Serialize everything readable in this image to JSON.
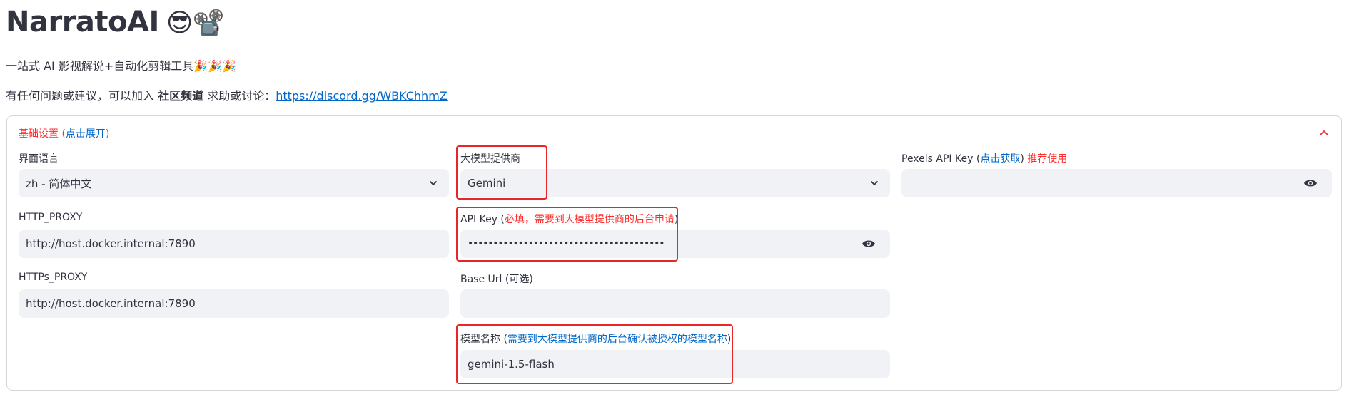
{
  "header": {
    "app_title": "NarratoAI",
    "title_emoji": "😎📽️",
    "subtitle": "一站式 AI 影视解说+自动化剪辑工具🎉🎉🎉",
    "help_prefix": "有任何问题或建议，可以加入 ",
    "help_bold": "社区频道",
    "help_middle": " 求助或讨论：",
    "help_link": "https://discord.gg/WBKChhmZ"
  },
  "expander": {
    "title": "基础设置",
    "title_paren_open": " (",
    "title_action": "点击展开",
    "title_paren_close": ")",
    "chevron_icon": "chevron-up-icon"
  },
  "settings": {
    "ui_language": {
      "label": "界面语言",
      "value": "zh - 简体中文"
    },
    "http_proxy": {
      "label": "HTTP_PROXY",
      "value": "http://host.docker.internal:7890"
    },
    "https_proxy": {
      "label": "HTTPs_PROXY",
      "value": "http://host.docker.internal:7890"
    },
    "llm_provider": {
      "label": "大模型提供商",
      "value": "Gemini"
    },
    "api_key": {
      "label": "API Key",
      "paren_open": " (",
      "hint": "必填，需要到大模型提供商的后台申请",
      "paren_close": ")",
      "value": "•••••••••••••••••••••••••••••••••••••••",
      "eye_icon": "eye-icon"
    },
    "base_url": {
      "label": "Base Url (可选)",
      "value": ""
    },
    "model_name": {
      "label": "模型名称",
      "paren_open": " (",
      "hint": "需要到大模型提供商的后台确认被授权的模型名称",
      "paren_close": ")",
      "value": "gemini-1.5-flash"
    },
    "pexels_key": {
      "label": "Pexels API Key",
      "paren_open": " (",
      "link": "点击获取",
      "paren_close": ")",
      "recommend": " 推荐使用",
      "value": "",
      "eye_icon": "eye-icon"
    }
  },
  "colors": {
    "accent_red": "#ff2b2b",
    "link_blue": "#0068c9",
    "field_bg": "#f0f2f6",
    "highlight": "#e8262a"
  }
}
